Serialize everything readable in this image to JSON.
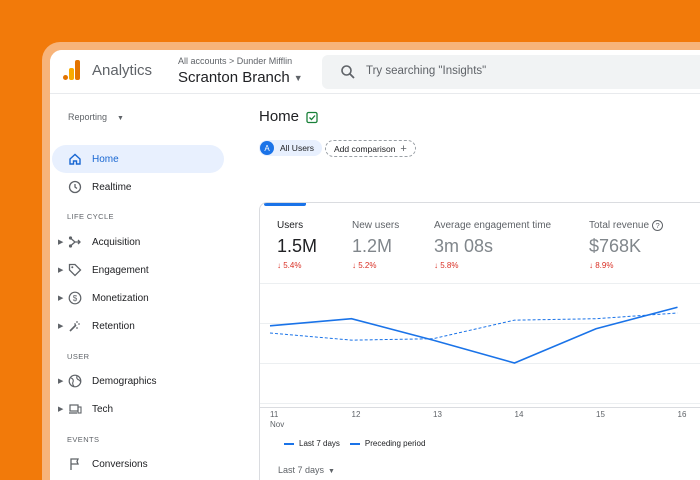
{
  "header": {
    "app_title": "Analytics",
    "breadcrumb": "All accounts > Dunder Mifflin",
    "property": "Scranton Branch",
    "search_placeholder": "Try searching \"Insights\""
  },
  "sidebar": {
    "reporting_label": "Reporting",
    "items": [
      {
        "label": "Home",
        "icon": "home-icon",
        "active": true
      },
      {
        "label": "Realtime",
        "icon": "clock-icon"
      }
    ],
    "sections": [
      {
        "title": "LIFE CYCLE",
        "items": [
          {
            "label": "Acquisition",
            "icon": "acquisition-icon"
          },
          {
            "label": "Engagement",
            "icon": "tag-icon"
          },
          {
            "label": "Monetization",
            "icon": "dollar-icon"
          },
          {
            "label": "Retention",
            "icon": "retention-icon"
          }
        ]
      },
      {
        "title": "USER",
        "items": [
          {
            "label": "Demographics",
            "icon": "globe-icon"
          },
          {
            "label": "Tech",
            "icon": "devices-icon"
          }
        ]
      },
      {
        "title": "EVENTS",
        "items": [
          {
            "label": "Conversions",
            "icon": "flag-icon"
          }
        ]
      }
    ]
  },
  "main": {
    "title": "Home",
    "segment_avatar": "A",
    "segment_label": "All Users",
    "add_comparison": "Add comparison",
    "metrics": [
      {
        "label": "Users",
        "value": "1.5M",
        "delta": "5.4%"
      },
      {
        "label": "New users",
        "value": "1.2M",
        "delta": "5.2%"
      },
      {
        "label": "Average engagement time",
        "value": "3m 08s",
        "delta": "5.8%"
      },
      {
        "label": "Total revenue",
        "value": "$768K",
        "delta": "8.9%"
      }
    ],
    "date_range": "Last 7 days"
  },
  "colors": {
    "accent": "#1a73e8",
    "negative": "#d93025",
    "background": "#f27a0a"
  },
  "chart_data": {
    "type": "line",
    "categories": [
      "11",
      "12",
      "13",
      "14",
      "15",
      "16"
    ],
    "x_sublabel": "Nov",
    "series": [
      {
        "name": "Last 7 days",
        "values": [
          1.07,
          1.12,
          0.97,
          0.81,
          1.05,
          1.2
        ]
      },
      {
        "name": "Preceding period",
        "values": [
          1.02,
          0.97,
          0.98,
          1.11,
          1.12,
          1.16
        ]
      }
    ]
  }
}
